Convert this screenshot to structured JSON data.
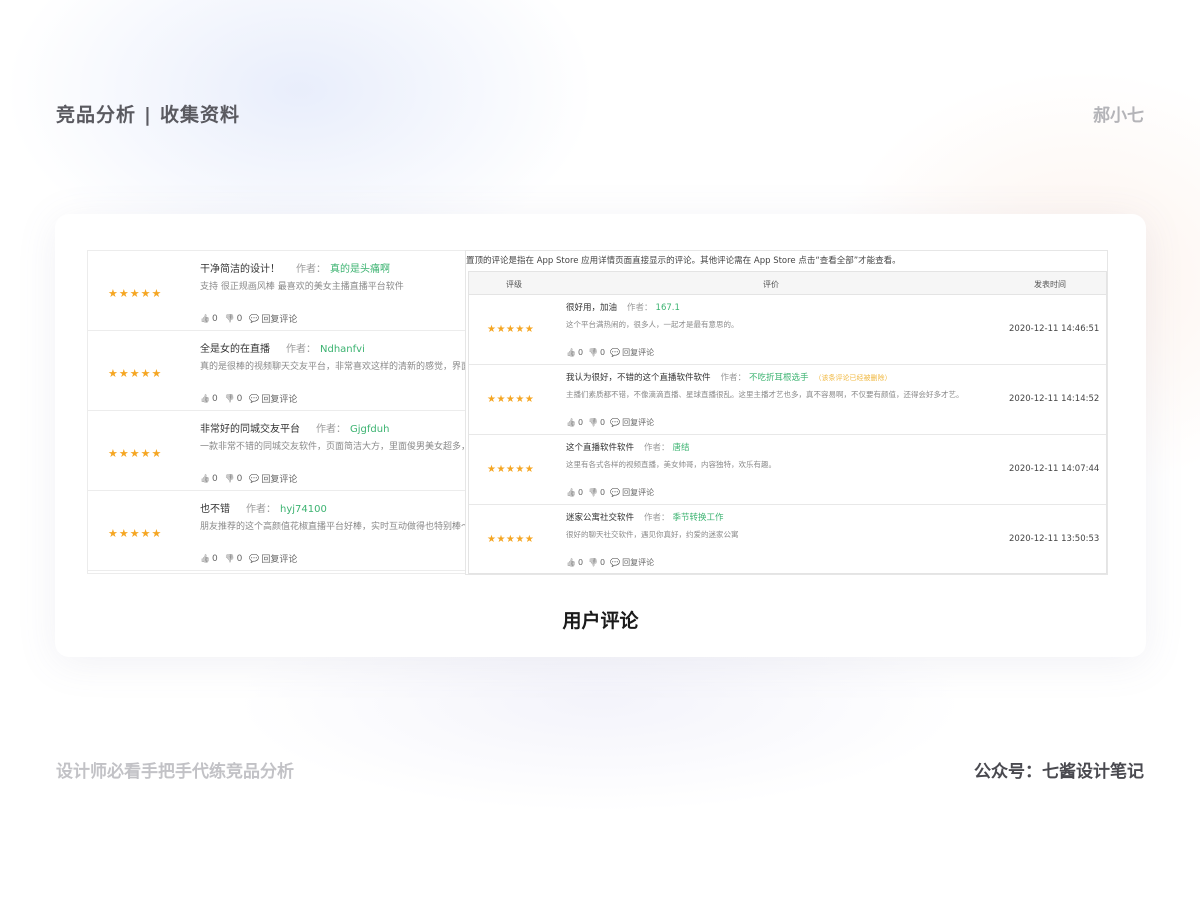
{
  "header": {
    "title_left": "竞品分析",
    "title_sep": "|",
    "title_right": "收集资料",
    "author": "郝小七"
  },
  "footer": {
    "left": "设计师必看手把手代练竞品分析",
    "right": "公众号：七酱设计笔记"
  },
  "card": {
    "caption": "用户评论"
  },
  "left_reviews": [
    {
      "stars": "★★★★★",
      "title": "干净简洁的设计！",
      "author_label": "作者：",
      "author": "真的是头痛啊",
      "body": "支持 很正规画风棒 最喜欢的美女主播直播平台软件",
      "likes": "0",
      "dislikes": "0",
      "reply": "回复评论"
    },
    {
      "stars": "★★★★★",
      "title": "全是女的在直播",
      "author_label": "作者：",
      "author": "Ndhanfvi",
      "body": "真的是很棒的视频聊天交友平台，非常喜欢这样的清新的感觉，界面设",
      "likes": "0",
      "dislikes": "0",
      "reply": "回复评论"
    },
    {
      "stars": "★★★★★",
      "title": "非常好的同城交友平台",
      "author_label": "作者：",
      "author": "Gjgfduh",
      "body": "一款非常不错的同城交友软件，页面简洁大方，里面俊男美女超多，快",
      "likes": "0",
      "dislikes": "0",
      "reply": "回复评论"
    },
    {
      "stars": "★★★★★",
      "title": "也不错",
      "author_label": "作者：",
      "author": "hyj74100",
      "body": "朋友推荐的这个高颜值花椒直播平台好棒，实时互动做得也特别棒～",
      "likes": "0",
      "dislikes": "0",
      "reply": "回复评论"
    }
  ],
  "right_panel": {
    "notice": "置顶的评论是指在 App Store 应用详情页面直接显示的评论。其他评论需在 App Store 点击“查看全部”才能查看。",
    "col_rating": "评级",
    "col_review": "评价",
    "col_time": "发表时间",
    "rows": [
      {
        "stars": "★★★★★",
        "title": "很好用，加油",
        "author_label": "作者：",
        "author": "167.1",
        "tag": "",
        "body": "这个平台满热闹的，很多人，一起才是最有意思的。",
        "likes": "0",
        "dislikes": "0",
        "reply": "回复评论",
        "time": "2020-12-11 14:46:51"
      },
      {
        "stars": "★★★★★",
        "title": "我认为很好，不错的这个直播软件软件",
        "author_label": "作者：",
        "author": "不吃折耳根选手",
        "tag": "（该条评论已经被删除）",
        "body": "主播们素质都不错，不像滴滴直播、星球直播很乱。这里主播才艺也多，真不容易啊，不仅要有颜值，还得会好多才艺。",
        "likes": "0",
        "dislikes": "0",
        "reply": "回复评论",
        "time": "2020-12-11 14:14:52"
      },
      {
        "stars": "★★★★★",
        "title": "这个直播软件软件",
        "author_label": "作者：",
        "author": "唐结",
        "tag": "",
        "body": "这里有各式各样的视频直播，美女帅哥，内容独特，欢乐有趣。",
        "likes": "0",
        "dislikes": "0",
        "reply": "回复评论",
        "time": "2020-12-11 14:07:44"
      },
      {
        "stars": "★★★★★",
        "title": "迷家公寓社交软件",
        "author_label": "作者：",
        "author": "季节转换工作",
        "tag": "",
        "body": "很好的聊天社交软件，遇见你真好，约爱的迷家公寓",
        "likes": "0",
        "dislikes": "0",
        "reply": "回复评论",
        "time": "2020-12-11 13:50:53"
      }
    ]
  },
  "icons": {
    "like": "thumbs-up-icon",
    "dislike": "thumbs-down-icon",
    "reply": "comment-icon"
  }
}
